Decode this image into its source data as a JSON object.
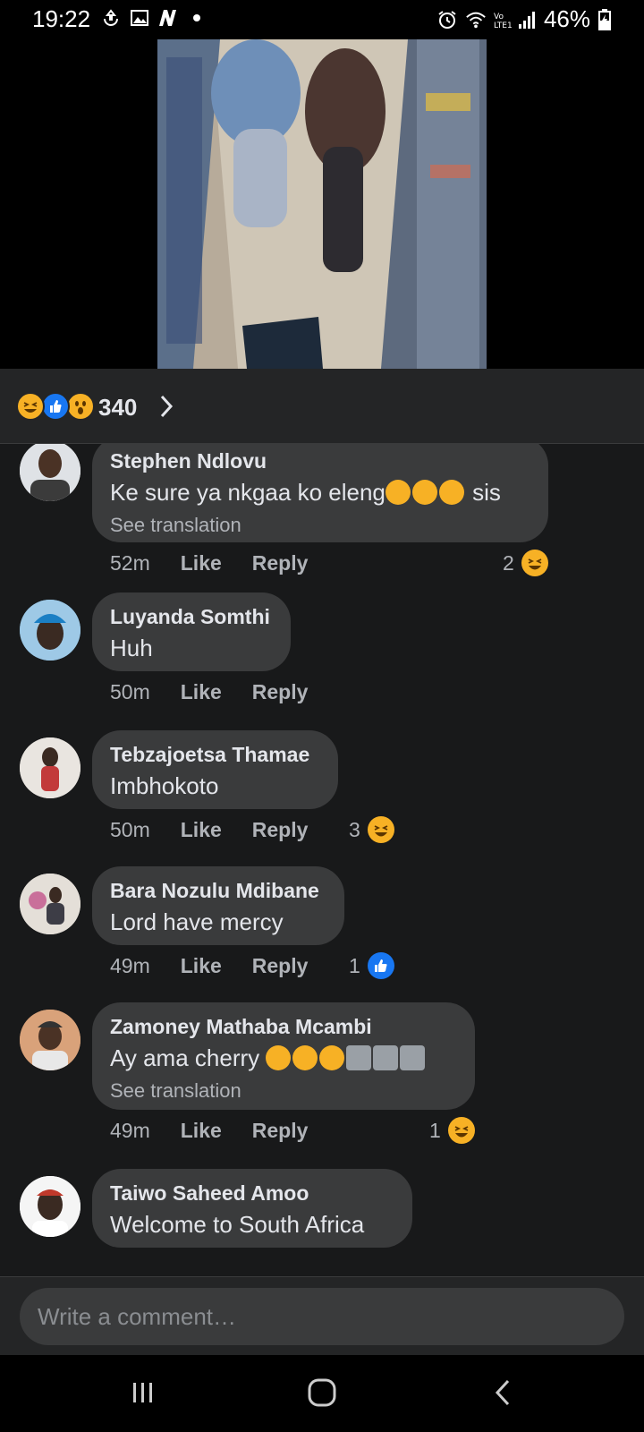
{
  "status_bar": {
    "time": "19:22",
    "battery": "46%",
    "left_icons": [
      "sync-icon",
      "gallery-icon",
      "n-app-icon",
      "dot-icon"
    ],
    "right_icons": [
      "alarm-icon",
      "wifi-icon",
      "volte-signal-icon",
      "battery-charging-icon"
    ]
  },
  "reactions": {
    "count": "340",
    "types": [
      "haha",
      "like",
      "wow"
    ]
  },
  "comments": [
    {
      "name": "Stephen Ndlovu",
      "text_before": "Ke sure ya nkgaa ko eleng",
      "text_after": " sis",
      "inline_emojis": [
        "rofl",
        "rofl",
        "rofl"
      ],
      "see_translation": "See translation",
      "time": "52m",
      "like": "Like",
      "reply": "Reply",
      "reaction_count": "2",
      "reaction_type": "haha"
    },
    {
      "name": "Luyanda Somthi",
      "text": "Huh",
      "time": "50m",
      "like": "Like",
      "reply": "Reply"
    },
    {
      "name": "Tebzajoetsa Thamae",
      "text": "Imbhokoto",
      "time": "50m",
      "like": "Like",
      "reply": "Reply",
      "reaction_count": "3",
      "reaction_type": "haha"
    },
    {
      "name": "Bara Nozulu Mdibane",
      "text": "Lord have mercy",
      "time": "49m",
      "like": "Like",
      "reply": "Reply",
      "reaction_count": "1",
      "reaction_type": "like"
    },
    {
      "name": "Zamoney Mathaba Mcambi",
      "text_before": "Ay ama cherry ",
      "inline_emojis": [
        "rofl",
        "rofl",
        "rofl",
        "tornado",
        "tornado",
        "tornado"
      ],
      "see_translation": "See translation",
      "time": "49m",
      "like": "Like",
      "reply": "Reply",
      "reaction_count": "1",
      "reaction_type": "haha"
    },
    {
      "name": "Taiwo Saheed Amoo",
      "text": "Welcome to South Africa"
    }
  ],
  "composer": {
    "placeholder": "Write a comment…"
  },
  "colors": {
    "background": "#18191a",
    "bubble": "#3a3b3c",
    "text_primary": "#e4e6eb",
    "text_secondary": "#b0b3b8",
    "like_blue": "#1877f2",
    "haha_yellow": "#f7b125"
  }
}
